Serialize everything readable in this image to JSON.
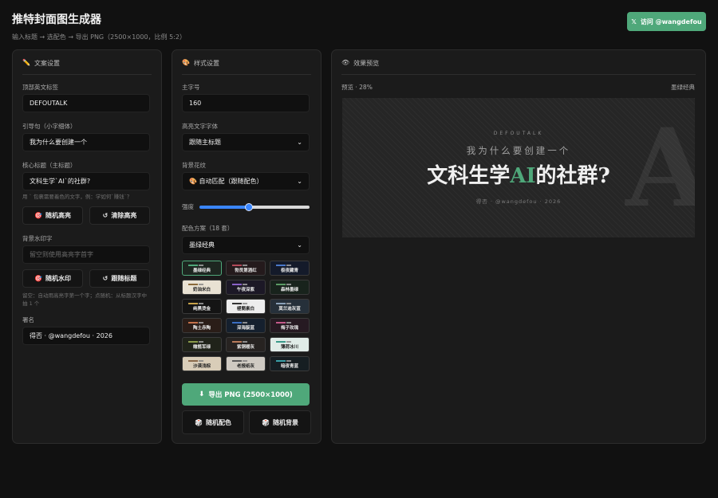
{
  "header": {
    "title": "推特封面图生成器",
    "subtitle": "输入标题 → 选配色 → 导出 PNG（2500×1000，比例 5:2）",
    "visit_label": "访问 @wangdefou",
    "visit_icon": "𝕏"
  },
  "copy_panel": {
    "title": "文案设置",
    "icon": "✏️",
    "tag_label": "顶部英文标签",
    "tag_value": "DEFOUTALK",
    "lead_label": "引导句（小字细体）",
    "lead_value": "我为什么要创建一个",
    "title_label": "核心标题（主标题）",
    "title_value": "文科生学`AI`的社群?",
    "title_hint": "用 ` 包裹需要着色的文字，例：学如何`赚钱`？",
    "random_hl": "随机高亮",
    "clear_hl": "清除高亮",
    "wm_label": "背景水印字",
    "wm_placeholder": "留空则使用高亮字首字",
    "random_wm": "随机水印",
    "follow_title": "跟随标题",
    "wm_hint": "留空：自动用高亮字第一个字；点随机：从标题汉字中抽 1 个",
    "sig_label": "署名",
    "sig_value": "得否 · @wangdefou · 2026"
  },
  "style_panel": {
    "title": "样式设置",
    "icon": "🎨",
    "size_label": "主字号",
    "size_value": "160",
    "font_label": "高亮文字字体",
    "font_value": "跟随主标题",
    "bg_label": "背景花纹",
    "bg_value": "🎨 自动匹配（跟随配色）",
    "strength_label": "强度",
    "strength_value": 0.45,
    "scheme_label": "配色方案（18 套）",
    "scheme_value": "墨绿经典",
    "export_label": "导出 PNG (2500×1000)",
    "random_color": "随机配色",
    "random_bg": "随机背景"
  },
  "swatches": [
    {
      "name": "墨绿经典",
      "bg": "#1d2620",
      "accent": "#4fa87a",
      "light": false,
      "selected": true
    },
    {
      "name": "勃艮第酒红",
      "bg": "#241a1c",
      "accent": "#b24a5a",
      "light": false
    },
    {
      "name": "极夜藏青",
      "bg": "#141a2a",
      "accent": "#4a78c8",
      "light": false
    },
    {
      "name": "奶油米白",
      "bg": "#e9e2d3",
      "accent": "#8a6a3a",
      "light": true
    },
    {
      "name": "午夜深紫",
      "bg": "#1c1826",
      "accent": "#8a62c8",
      "light": false
    },
    {
      "name": "森林墨绿",
      "bg": "#18231c",
      "accent": "#5a9a64",
      "light": false
    },
    {
      "name": "纯黑烫金",
      "bg": "#141414",
      "accent": "#c8a24a",
      "light": false
    },
    {
      "name": "極簡素白",
      "bg": "#ededed",
      "accent": "#333333",
      "light": true
    },
    {
      "name": "莫兰迪灰蓝",
      "bg": "#26303a",
      "accent": "#8aa0b8",
      "light": false
    },
    {
      "name": "陶土赤陶",
      "bg": "#2a1d18",
      "accent": "#c4704a",
      "light": false
    },
    {
      "name": "深海靛蓝",
      "bg": "#15202e",
      "accent": "#3a6ec2",
      "light": false
    },
    {
      "name": "梅子玫瑰",
      "bg": "#261a22",
      "accent": "#c45a8a",
      "light": false
    },
    {
      "name": "橄榄军绿",
      "bg": "#20231a",
      "accent": "#8a9a4a",
      "light": false
    },
    {
      "name": "紫铜暖灰",
      "bg": "#272321",
      "accent": "#b87a5a",
      "light": false
    },
    {
      "name": "薄荷冰川",
      "bg": "#e0ece8",
      "accent": "#3a9a8a",
      "light": true
    },
    {
      "name": "沙漠浅棕",
      "bg": "#d9cdb8",
      "accent": "#8a6a4a",
      "light": true
    },
    {
      "name": "老报纸灰",
      "bg": "#cfcac2",
      "accent": "#5a5a5a",
      "light": true
    },
    {
      "name": "暗夜青蓝",
      "bg": "#161e22",
      "accent": "#3aa0a8",
      "light": false
    }
  ],
  "preview_panel": {
    "title": "效果预览",
    "icon": "👁",
    "scale_label": "预览 · 28%",
    "scheme_name": "墨绿经典",
    "watermark": "A",
    "tag": "DEFOUTALK",
    "lead": "我为什么要创建一个",
    "title_pre": "文科生学",
    "title_hl": "AI",
    "title_post": "的社群?",
    "signature": "得否  ·  @wangdefou  ·  2026"
  },
  "colors": {
    "accent": "#4fa87a",
    "bg": "#111111",
    "panel": "#1b1b1b"
  }
}
